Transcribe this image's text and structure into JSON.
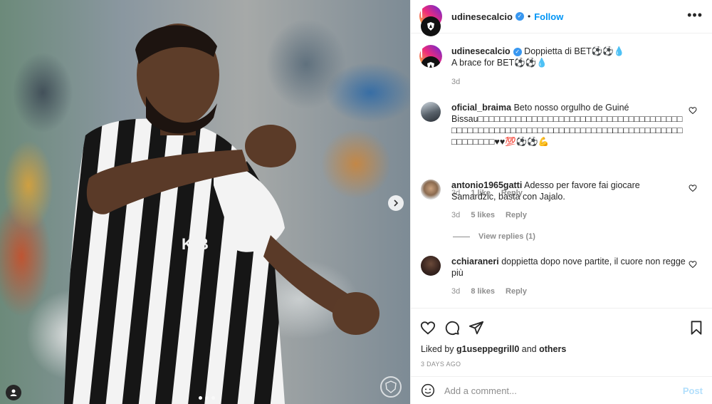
{
  "colors": {
    "accent": "#0095f6",
    "verified": "#3897f0",
    "muted": "#8e8e8e",
    "post_disabled": "#b2dffc"
  },
  "media": {
    "next_icon": "chevron-right-icon",
    "user_tag_icon": "user-icon",
    "dots_count": 3,
    "active_dot": 0
  },
  "header": {
    "username": "udinesecalcio",
    "separator": "•",
    "follow_label": "Follow",
    "more_icon": "more-horizontal-icon"
  },
  "caption": {
    "username": "udinesecalcio",
    "line1": "Doppietta di BET⚽⚽💧",
    "line2": "A brace for BET⚽⚽💧",
    "time": "3d"
  },
  "comments": [
    {
      "username": "oficial_braima",
      "text": "Beto nosso orgulho de Guiné Bissau□□□□□□□□□□□□□□□□□□□□□□□□□□□□□□□□□□□□□□□□□□□□□□□□□□□□□□□□□□□□□□□□□□□□□□□□□□□□□□□□□□□□□□□□□♥♥💯⚽⚽💪",
      "extra": "💪💪💪💪💪💪💪💪",
      "time": "3d",
      "likes": "1 like",
      "reply": "Reply"
    },
    {
      "username": "antonio1965gatti",
      "text": "Adesso per favore fai giocare Samardzic, basta con Jajalo.",
      "time": "3d",
      "likes": "5 likes",
      "reply": "Reply",
      "view_replies": "View replies (1)"
    },
    {
      "username": "cchiaraneri",
      "text": "doppietta dopo nove partite, il cuore non regge più",
      "time": "3d",
      "likes": "8 likes",
      "reply": "Reply"
    }
  ],
  "actions": {
    "liked_by_prefix": "Liked by",
    "liked_by_user": "g1useppegrill0",
    "liked_by_and": "and",
    "liked_by_others": "others",
    "time_ago": "3 DAYS AGO"
  },
  "add_comment": {
    "placeholder": "Add a comment...",
    "post_label": "Post"
  }
}
